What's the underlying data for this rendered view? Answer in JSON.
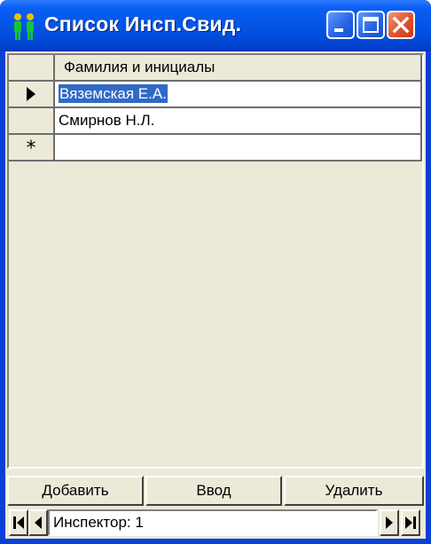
{
  "window": {
    "title": "Список Инсп.Свид."
  },
  "grid": {
    "column_header": "Фамилия и инициалы",
    "rows": [
      {
        "name": "Вяземская Е.А.",
        "current": true
      },
      {
        "name": "Смирнов Н.Л.",
        "current": false
      }
    ],
    "new_row_marker": "*"
  },
  "buttons": {
    "add": "Добавить",
    "enter": "Ввод",
    "delete": "Удалить"
  },
  "navigator": {
    "label": "Инспектор:",
    "value": "1"
  },
  "icons": {
    "app": "people-icon",
    "minimize": "minimize-icon",
    "maximize": "maximize-icon",
    "close": "close-icon",
    "current_row": "record-pointer-icon",
    "new_row": "asterisk-icon",
    "first": "first-record-icon",
    "prev": "previous-record-icon",
    "next": "next-record-icon",
    "last": "last-record-icon"
  },
  "colors": {
    "titlebar": "#0355e6",
    "selection": "#316ac5",
    "face": "#ece9d8",
    "close_button": "#e2512c"
  }
}
